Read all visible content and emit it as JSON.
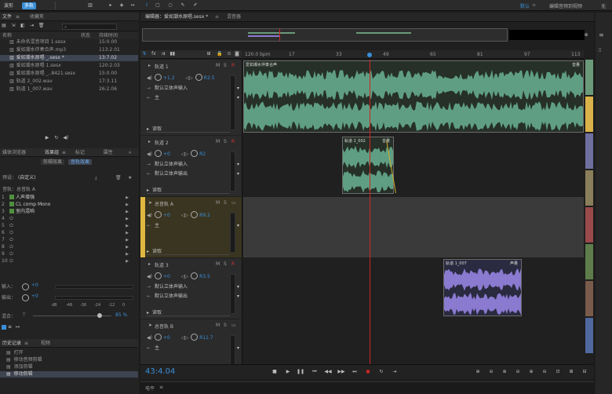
{
  "topbar": {
    "waveform_tab": "波形",
    "multitrack_tab": "多轨",
    "default_label": "默认",
    "edit_audio_label": "编辑音频到视频",
    "right_cut": "无"
  },
  "files": {
    "tab1": "文件",
    "tab2": "收藏夹",
    "col_name": "名称",
    "col_status": "状态",
    "col_duration": "持续时间",
    "items": [
      {
        "name": "未命名混音项目 1.sesx",
        "dur": "15:0.00"
      },
      {
        "name": "爱如潮水伴奏合声.mp3",
        "dur": "113:2.01"
      },
      {
        "name": "爱如潮水原唱 _.sesx *",
        "dur": "13:7.02"
      },
      {
        "name": "爱如潮水原唱 1.sesx",
        "dur": "120:2.03"
      },
      {
        "name": "爱如潮水原唱 _..8421.sesx",
        "dur": "15:0.00"
      },
      {
        "name": "轨道 2_002.wav",
        "dur": "17:3.11"
      },
      {
        "name": "轨道 1_007.wav",
        "dur": "26:2.06"
      }
    ]
  },
  "effects": {
    "tab_media": "媒体浏览器",
    "tab_effects": "效果组",
    "tab_markers": "标记",
    "tab_props": "属性",
    "sub_clip": "剪辑效果",
    "sub_track": "音轨效果",
    "preset_label": "预设：",
    "preset_value": "(自定义)",
    "track_label": "音轨：总音轨 A",
    "slots": [
      {
        "n": "1",
        "name": "人声增强"
      },
      {
        "n": "2",
        "name": "CL comp Mono"
      },
      {
        "n": "3",
        "name": "室内混响"
      },
      {
        "n": "4",
        "name": ""
      },
      {
        "n": "5",
        "name": ""
      },
      {
        "n": "6",
        "name": ""
      },
      {
        "n": "7",
        "name": ""
      },
      {
        "n": "8",
        "name": ""
      },
      {
        "n": "9",
        "name": ""
      },
      {
        "n": "10",
        "name": ""
      }
    ],
    "input_label": "输入：",
    "output_label": "输出：",
    "input_val": "+0",
    "output_val": "+0",
    "mix_label": "混合：",
    "mix_pct": "85 %",
    "scale": [
      "dB",
      "-48",
      "-36",
      "-24",
      "-12",
      "0"
    ]
  },
  "history": {
    "tab1": "历史记录",
    "tab2": "视频",
    "items": [
      "打开",
      "移动音频剪辑",
      "添加剪辑",
      "移动剪辑"
    ]
  },
  "editor": {
    "tab": "编辑器：爱如潮水原唱.sesx *",
    "mixer": "混音器",
    "time": "43:4.04",
    "level_label": "电平",
    "ruler": {
      "bpm": "120.0 bpm",
      "ticks": [
        "17",
        "33",
        "49",
        "65",
        "81",
        "97",
        "113"
      ]
    },
    "tracks": [
      {
        "name": "轨道 1",
        "vol": "+1.2",
        "pan": "R2.5",
        "in": "默认立体声输入",
        "out": "主",
        "read": "读取",
        "clip": "爱如潮水伴奏合声",
        "clip_right": "音量"
      },
      {
        "name": "轨道 2",
        "vol": "+0",
        "pan": "R2",
        "in": "默认立体声输入",
        "out": "默认立体声输出",
        "read": "读取",
        "clip": "轨道 2_002",
        "clip_right": "音量"
      },
      {
        "name": "总音轨 A",
        "vol": "+0",
        "pan": "R9.2",
        "out": "主",
        "read": "读取"
      },
      {
        "name": "轨道 3",
        "vol": "+0",
        "pan": "R3.5",
        "in": "默认立体声输入",
        "out": "默认立体声输出",
        "read": "读取",
        "clip": "轨道 1_007",
        "clip_right": "声量"
      },
      {
        "name": "总音轨 B",
        "vol": "+0",
        "pan": "R11.7",
        "out": "主"
      }
    ]
  },
  "colors": {
    "accent": "#3a8fd8",
    "wave_green": "#5f9e82",
    "wave_purple": "#8a7ad0",
    "playhead": "#d02525",
    "bus_yellow": "#e0b840"
  },
  "palette": [
    "#6a9a7a",
    "#d9b24a",
    "#6f6fa0",
    "#8a7f5a",
    "#9a4a4a",
    "#5e7d4a",
    "#7a5a4a",
    "#5068a0"
  ]
}
